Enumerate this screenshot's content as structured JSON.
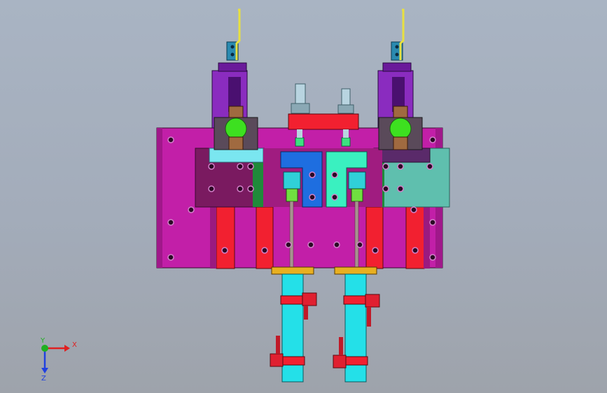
{
  "viewport": {
    "background_color": "#a7b0be",
    "model_name": "",
    "view": "front"
  },
  "triad": {
    "x_label": "X",
    "y_label": "Y",
    "z_label": "Z",
    "x_color": "#e02020",
    "y_color": "#20b020",
    "z_color": "#2040e0"
  },
  "colors": {
    "main_plate": "#c21fa8",
    "red_rail": "#f22030",
    "dark_plate": "#7a1a60",
    "teal_plate": "#5fbfae",
    "purple_bracket": "#8a2cbf",
    "cyan_cylinder": "#24e0e8",
    "green_knob": "#3de020",
    "blue_block": "#1e6ee0",
    "aqua_block": "#3af0c0",
    "yellow_sensor": "#e8e040"
  }
}
